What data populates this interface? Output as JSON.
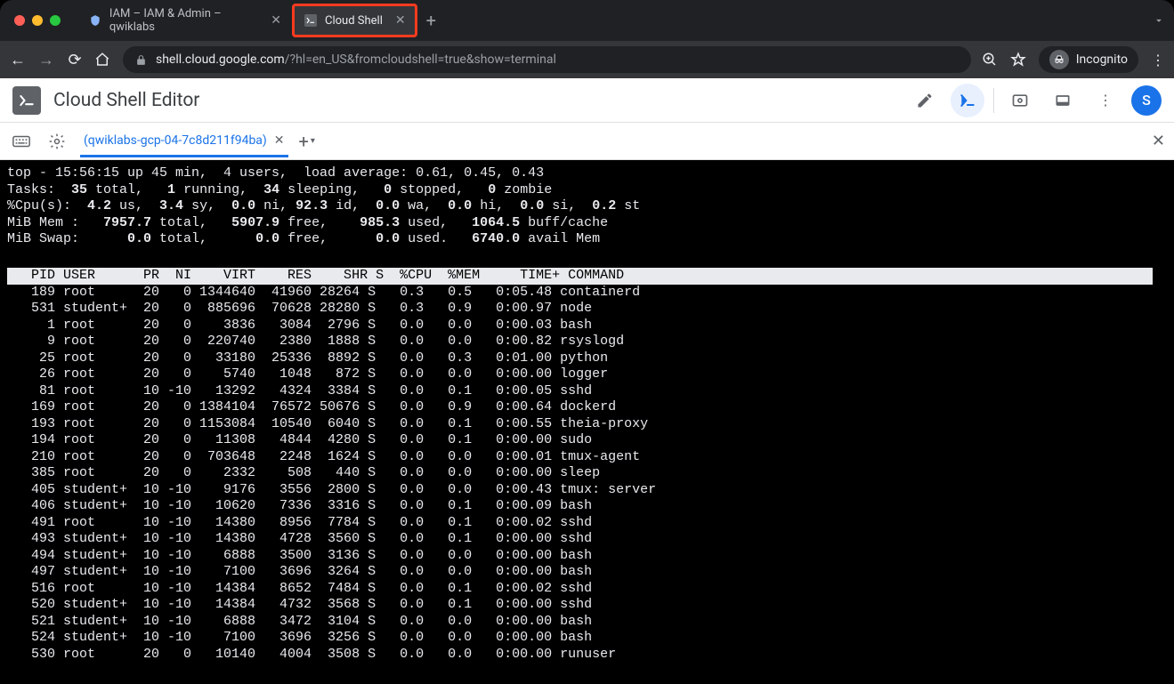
{
  "browser": {
    "tabs": [
      {
        "title": "IAM – IAM & Admin – qwiklabs",
        "active": false
      },
      {
        "title": "Cloud Shell",
        "active": true,
        "highlighted": true
      }
    ],
    "url_host": "shell.cloud.google.com",
    "url_path": "/?hl=en_US&fromcloudshell=true&show=terminal",
    "incognito_label": "Incognito"
  },
  "app": {
    "title": "Cloud Shell Editor",
    "avatar_letter": "S",
    "terminal_tab": "(qwiklabs-gcp-04-7c8d211f94ba)"
  },
  "top_summary": {
    "line1": "top - 15:56:15 up 45 min,  4 users,  load average: 0.61, 0.45, 0.43",
    "tasks": {
      "total": "35",
      "running": "1",
      "sleeping": "34",
      "stopped": "0",
      "zombie": "0"
    },
    "cpu": {
      "us": "4.2",
      "sy": "3.4",
      "ni": "0.0",
      "id": "92.3",
      "wa": "0.0",
      "hi": "0.0",
      "si": "0.0",
      "st": "0.2"
    },
    "mem": {
      "total": "7957.7",
      "free": "5907.9",
      "used": "985.3",
      "buff": "1064.5"
    },
    "swap": {
      "total": "0.0",
      "free": "0.0",
      "used": "0.0",
      "avail": "6740.0"
    }
  },
  "columns": "   PID USER      PR  NI    VIRT    RES    SHR S  %CPU  %MEM     TIME+ COMMAND",
  "processes": [
    {
      "pid": "189",
      "user": "root    ",
      "pr": "20",
      "ni": "  0",
      "virt": "1344640",
      "res": " 41960",
      "shr": "28264",
      "s": "S",
      "cpu": " 0.3",
      "mem": " 0.5",
      "time": "0:05.48",
      "cmd": "containerd"
    },
    {
      "pid": "531",
      "user": "student+",
      "pr": "20",
      "ni": "  0",
      "virt": " 885696",
      "res": " 70628",
      "shr": "28280",
      "s": "S",
      "cpu": " 0.3",
      "mem": " 0.9",
      "time": "0:00.97",
      "cmd": "node"
    },
    {
      "pid": "1",
      "user": "root    ",
      "pr": "20",
      "ni": "  0",
      "virt": "   3836",
      "res": "  3084",
      "shr": " 2796",
      "s": "S",
      "cpu": " 0.0",
      "mem": " 0.0",
      "time": "0:00.03",
      "cmd": "bash"
    },
    {
      "pid": "9",
      "user": "root    ",
      "pr": "20",
      "ni": "  0",
      "virt": " 220740",
      "res": "  2380",
      "shr": " 1888",
      "s": "S",
      "cpu": " 0.0",
      "mem": " 0.0",
      "time": "0:00.82",
      "cmd": "rsyslogd"
    },
    {
      "pid": "25",
      "user": "root    ",
      "pr": "20",
      "ni": "  0",
      "virt": "  33180",
      "res": " 25336",
      "shr": " 8892",
      "s": "S",
      "cpu": " 0.0",
      "mem": " 0.3",
      "time": "0:01.00",
      "cmd": "python"
    },
    {
      "pid": "26",
      "user": "root    ",
      "pr": "20",
      "ni": "  0",
      "virt": "   5740",
      "res": "  1048",
      "shr": "  872",
      "s": "S",
      "cpu": " 0.0",
      "mem": " 0.0",
      "time": "0:00.00",
      "cmd": "logger"
    },
    {
      "pid": "81",
      "user": "root    ",
      "pr": "10",
      "ni": "-10",
      "virt": "  13292",
      "res": "  4324",
      "shr": " 3384",
      "s": "S",
      "cpu": " 0.0",
      "mem": " 0.1",
      "time": "0:00.05",
      "cmd": "sshd"
    },
    {
      "pid": "169",
      "user": "root    ",
      "pr": "20",
      "ni": "  0",
      "virt": "1384104",
      "res": " 76572",
      "shr": "50676",
      "s": "S",
      "cpu": " 0.0",
      "mem": " 0.9",
      "time": "0:00.64",
      "cmd": "dockerd"
    },
    {
      "pid": "193",
      "user": "root    ",
      "pr": "20",
      "ni": "  0",
      "virt": "1153084",
      "res": " 10540",
      "shr": " 6040",
      "s": "S",
      "cpu": " 0.0",
      "mem": " 0.1",
      "time": "0:00.55",
      "cmd": "theia-proxy"
    },
    {
      "pid": "194",
      "user": "root    ",
      "pr": "20",
      "ni": "  0",
      "virt": "  11308",
      "res": "  4844",
      "shr": " 4280",
      "s": "S",
      "cpu": " 0.0",
      "mem": " 0.1",
      "time": "0:00.00",
      "cmd": "sudo"
    },
    {
      "pid": "210",
      "user": "root    ",
      "pr": "20",
      "ni": "  0",
      "virt": " 703648",
      "res": "  2248",
      "shr": " 1624",
      "s": "S",
      "cpu": " 0.0",
      "mem": " 0.0",
      "time": "0:00.01",
      "cmd": "tmux-agent"
    },
    {
      "pid": "385",
      "user": "root    ",
      "pr": "20",
      "ni": "  0",
      "virt": "   2332",
      "res": "   508",
      "shr": "  440",
      "s": "S",
      "cpu": " 0.0",
      "mem": " 0.0",
      "time": "0:00.00",
      "cmd": "sleep"
    },
    {
      "pid": "405",
      "user": "student+",
      "pr": "10",
      "ni": "-10",
      "virt": "   9176",
      "res": "  3556",
      "shr": " 2800",
      "s": "S",
      "cpu": " 0.0",
      "mem": " 0.0",
      "time": "0:00.43",
      "cmd": "tmux: server"
    },
    {
      "pid": "406",
      "user": "student+",
      "pr": "10",
      "ni": "-10",
      "virt": "  10620",
      "res": "  7336",
      "shr": " 3316",
      "s": "S",
      "cpu": " 0.0",
      "mem": " 0.1",
      "time": "0:00.09",
      "cmd": "bash"
    },
    {
      "pid": "491",
      "user": "root    ",
      "pr": "10",
      "ni": "-10",
      "virt": "  14380",
      "res": "  8956",
      "shr": " 7784",
      "s": "S",
      "cpu": " 0.0",
      "mem": " 0.1",
      "time": "0:00.02",
      "cmd": "sshd"
    },
    {
      "pid": "493",
      "user": "student+",
      "pr": "10",
      "ni": "-10",
      "virt": "  14380",
      "res": "  4728",
      "shr": " 3560",
      "s": "S",
      "cpu": " 0.0",
      "mem": " 0.1",
      "time": "0:00.00",
      "cmd": "sshd"
    },
    {
      "pid": "494",
      "user": "student+",
      "pr": "10",
      "ni": "-10",
      "virt": "   6888",
      "res": "  3500",
      "shr": " 3136",
      "s": "S",
      "cpu": " 0.0",
      "mem": " 0.0",
      "time": "0:00.00",
      "cmd": "bash"
    },
    {
      "pid": "497",
      "user": "student+",
      "pr": "10",
      "ni": "-10",
      "virt": "   7100",
      "res": "  3696",
      "shr": " 3264",
      "s": "S",
      "cpu": " 0.0",
      "mem": " 0.0",
      "time": "0:00.00",
      "cmd": "bash"
    },
    {
      "pid": "516",
      "user": "root    ",
      "pr": "10",
      "ni": "-10",
      "virt": "  14384",
      "res": "  8652",
      "shr": " 7484",
      "s": "S",
      "cpu": " 0.0",
      "mem": " 0.1",
      "time": "0:00.02",
      "cmd": "sshd"
    },
    {
      "pid": "520",
      "user": "student+",
      "pr": "10",
      "ni": "-10",
      "virt": "  14384",
      "res": "  4732",
      "shr": " 3568",
      "s": "S",
      "cpu": " 0.0",
      "mem": " 0.1",
      "time": "0:00.00",
      "cmd": "sshd"
    },
    {
      "pid": "521",
      "user": "student+",
      "pr": "10",
      "ni": "-10",
      "virt": "   6888",
      "res": "  3472",
      "shr": " 3104",
      "s": "S",
      "cpu": " 0.0",
      "mem": " 0.0",
      "time": "0:00.00",
      "cmd": "bash"
    },
    {
      "pid": "524",
      "user": "student+",
      "pr": "10",
      "ni": "-10",
      "virt": "   7100",
      "res": "  3696",
      "shr": " 3256",
      "s": "S",
      "cpu": " 0.0",
      "mem": " 0.0",
      "time": "0:00.00",
      "cmd": "bash"
    },
    {
      "pid": "530",
      "user": "root    ",
      "pr": "20",
      "ni": "  0",
      "virt": "  10140",
      "res": "  4004",
      "shr": " 3508",
      "s": "S",
      "cpu": " 0.0",
      "mem": " 0.0",
      "time": "0:00.00",
      "cmd": "runuser"
    }
  ]
}
